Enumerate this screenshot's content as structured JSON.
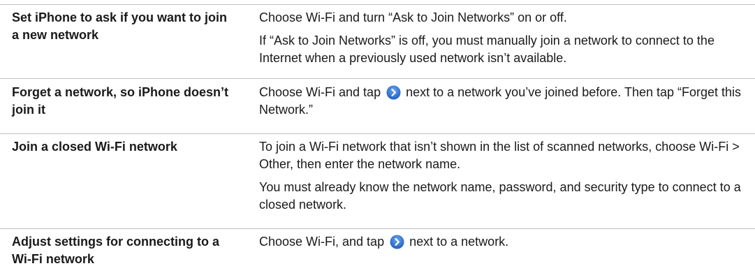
{
  "rows": [
    {
      "task": "Set iPhone to ask if you want to join a new network",
      "desc_1": "Choose Wi-Fi and turn “Ask to Join Networks” on or off.",
      "desc_2": "If “Ask to Join Networks” is off, you must manually join a network to connect to the Internet when a previously used network isn’t available."
    },
    {
      "task": "Forget a network, so iPhone doesn’t join it",
      "desc_pre": "Choose Wi-Fi and tap",
      "desc_post": "next to a network you’ve joined before. Then tap “Forget this Network.”"
    },
    {
      "task": "Join a closed Wi-Fi network",
      "desc_1": "To join a Wi-Fi network that isn’t shown in the list of scanned networks, choose Wi-Fi > Other, then enter the network name.",
      "desc_2": "You must already know the network name, password, and security type to connect to a closed network."
    },
    {
      "task": "Adjust settings for connecting to a Wi-Fi network",
      "desc_pre": "Choose Wi-Fi, and tap",
      "desc_post": "next to a network."
    }
  ],
  "icons": {
    "detail": "detail-disclosure-icon"
  },
  "colors": {
    "rule": "#bdbdbd",
    "icon": "#2f78d4"
  }
}
